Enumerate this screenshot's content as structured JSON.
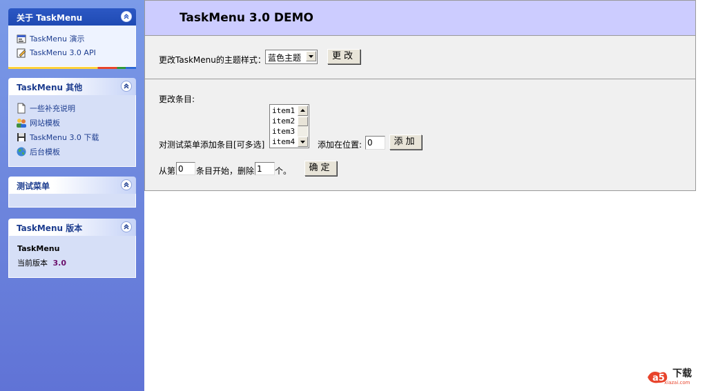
{
  "sidebar": {
    "panels": [
      {
        "title": "关于 TaskMenu",
        "items": [
          {
            "label": "TaskMenu 演示",
            "icon": "window-properties-icon"
          },
          {
            "label": "TaskMenu 3.0 API",
            "icon": "edit-document-icon"
          }
        ]
      },
      {
        "title": "TaskMenu 其他",
        "items": [
          {
            "label": "一些补充说明",
            "icon": "document-icon"
          },
          {
            "label": "网站模板",
            "icon": "users-icon"
          },
          {
            "label": "TaskMenu 3.0 下载",
            "icon": "floppy-disk-icon"
          },
          {
            "label": "后台模板",
            "icon": "globe-icon"
          }
        ]
      },
      {
        "title": "测试菜单",
        "items": []
      },
      {
        "title": "TaskMenu 版本",
        "product": "TaskMenu",
        "version_label": "当前版本",
        "version_value": "3.0"
      }
    ]
  },
  "main": {
    "title": "TaskMenu 3.0 DEMO",
    "theme": {
      "label": "更改TaskMenu的主题样式：",
      "selected": "蓝色主题",
      "button": "更改"
    },
    "items": {
      "label": "更改条目:",
      "add_label": "对测试菜单添加条目[可多选]",
      "list_options": [
        "item1",
        "item2",
        "item3",
        "item4"
      ],
      "position_label": "添加在位置:",
      "position_value": "0",
      "add_button": "添加",
      "delete_prefix": "从第",
      "delete_start_value": "0",
      "delete_middle": "条目开始，删除",
      "delete_count_value": "1",
      "delete_suffix": "个。",
      "confirm_button": "确定"
    }
  },
  "watermark": {
    "brand": "a5",
    "text": "下载",
    "url": "xiazai.com"
  },
  "colors": {
    "sidebar_bg": "#6d86dd",
    "header_bg": "#ccccff",
    "panel_special_head": "#2c58c4",
    "link_text": "#1d3d8f",
    "version_value": "#6b0f6b"
  }
}
